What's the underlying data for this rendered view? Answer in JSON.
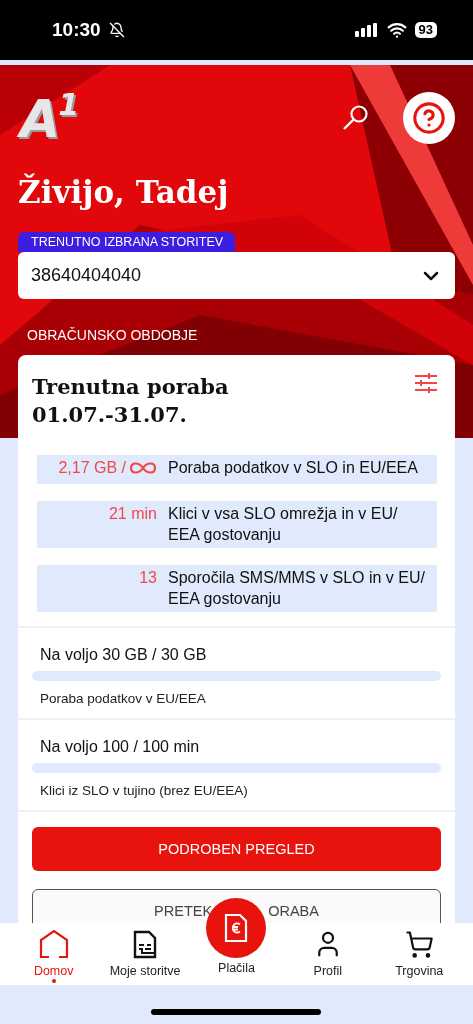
{
  "status_bar": {
    "time": "10:30",
    "silent": true,
    "battery": "93"
  },
  "header": {
    "logo": {
      "main": "A",
      "superscript": "1"
    },
    "greeting": "Živijo, Tadej",
    "service_label": "TRENUTNO IZBRANA STORITEV",
    "service_value": "38640404040",
    "period_label": "OBRAČUNSKO OBDOBJE"
  },
  "usage_card": {
    "title": "Trenutna poraba",
    "period": "01.07.-31.07.",
    "usage_items": [
      {
        "amount": "2,17 GB /",
        "unlimited": true,
        "description": "Poraba podatkov v SLO in EU/EEA"
      },
      {
        "amount": "21 min",
        "unlimited": false,
        "description": "Klici v vsa SLO omrežja in v EU/ EEA gostovanju"
      },
      {
        "amount": "13",
        "unlimited": false,
        "description": "Sporočila SMS/MMS v SLO in v EU/ EEA gostovanju"
      }
    ],
    "allowances": [
      {
        "title": "Na voljo 30 GB / 30 GB",
        "level": 0,
        "caption": "Poraba podatkov v EU/EEA"
      },
      {
        "title": "Na voljo 100 / 100 min",
        "level": 0,
        "caption": "Klici iz SLO v tujino (brez EU/EEA)"
      }
    ],
    "buttons": [
      {
        "label": "PODROBEN PREGLED",
        "kind": "primary"
      },
      {
        "label_parts": [
          "PRETEK",
          "ORABA"
        ],
        "kind": "outline"
      }
    ]
  },
  "bottom_nav": [
    {
      "label": "Domov",
      "kind": "home",
      "selected": true
    },
    {
      "label": "Moje storitve",
      "kind": "services",
      "selected": false
    },
    {
      "label": "Plačila",
      "kind": "payments",
      "selected": false
    },
    {
      "label": "Profil",
      "kind": "profile",
      "selected": false
    },
    {
      "label": "Trgovina",
      "kind": "shop",
      "selected": false
    }
  ]
}
